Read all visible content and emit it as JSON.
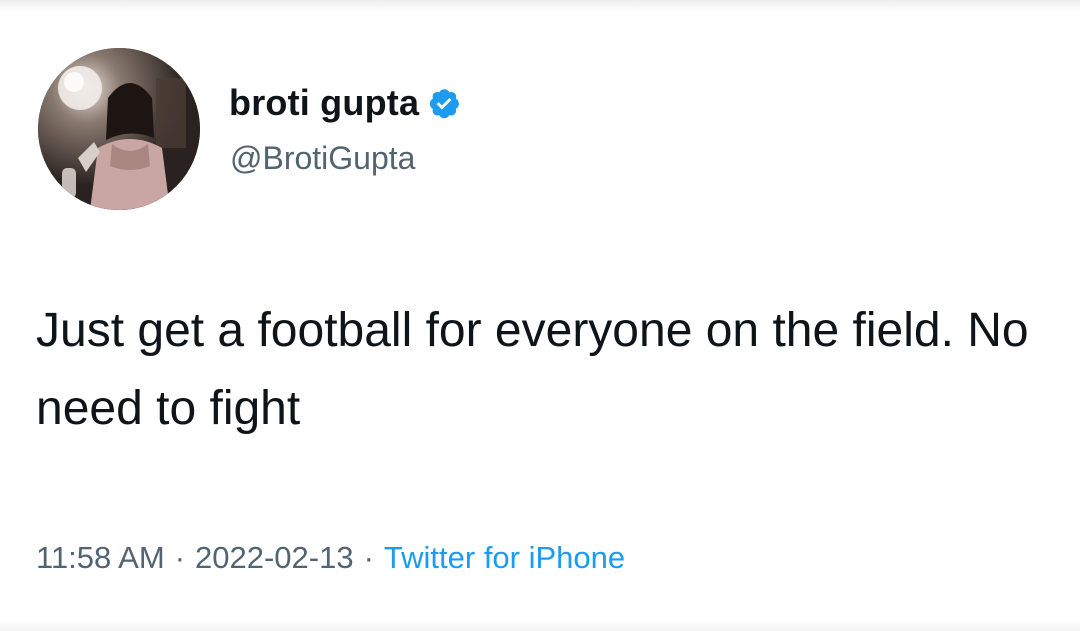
{
  "tweet": {
    "author": {
      "display_name": "broti gupta",
      "handle": "@BrotiGupta",
      "verified": true
    },
    "text": "Just get a football for everyone on the field. No need to fight",
    "time": "11:58 AM",
    "separator": "·",
    "date": "2022-02-13",
    "source": "Twitter for iPhone"
  },
  "colors": {
    "text": "#0f1419",
    "secondary": "#536471",
    "accent": "#1d9bf0"
  },
  "icons": {
    "verified": "verified-badge-icon"
  }
}
